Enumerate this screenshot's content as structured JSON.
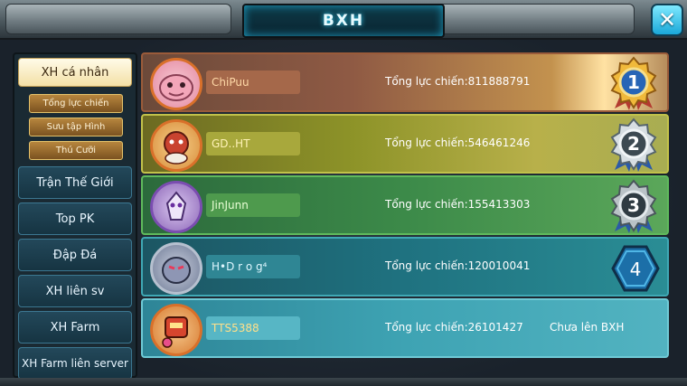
{
  "header": {
    "title": "BXH",
    "close_label": "✕"
  },
  "sidebar": {
    "active_tab": "XH cá nhân",
    "sub_tabs": [
      "Tổng lực chiến",
      "Sưu tập Hình",
      "Thú Cưỡi"
    ],
    "tabs": [
      "Trận Thế Giới",
      "Top PK",
      "Đập Đá",
      "XH liên sv",
      "XH Farm",
      "XH Farm liên server"
    ]
  },
  "rows": [
    {
      "name": "ChiPuu",
      "power": "Tổng lực chiến:811888791",
      "rank": "1",
      "name_color": "#ffd9a8",
      "name_bg": "#a5684a"
    },
    {
      "name": "GD..HT",
      "power": "Tổng lực chiến:546461246",
      "rank": "2",
      "name_color": "#fff3b8",
      "name_bg": "#a8a83c"
    },
    {
      "name": "JinJunn",
      "power": "Tổng lực chiến:155413303",
      "rank": "3",
      "name_color": "#eaffd6",
      "name_bg": "#4e9a4d"
    },
    {
      "name": "H•D r o g⁴",
      "power": "Tổng lực chiến:120010041",
      "rank": "4",
      "name_color": "#dff7ff",
      "name_bg": "#2f8694"
    },
    {
      "name": "TTS5388",
      "power": "Tổng lực chiến:26101427",
      "rank_text": "Chưa lên BXH",
      "name_color": "#ffe08a",
      "name_bg": "#57b6c5"
    }
  ],
  "colors": {
    "accent": "#35d6ff",
    "gold": "#e8b53e",
    "silver": "#c7d3da",
    "rank4_hex": "#1c6fa8"
  }
}
